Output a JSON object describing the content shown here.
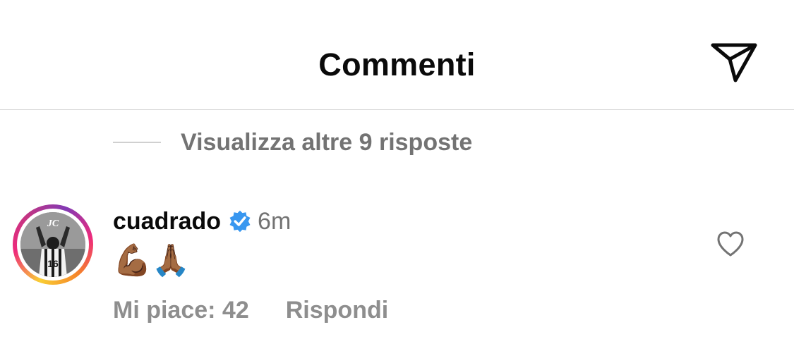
{
  "header": {
    "title": "Commenti",
    "share_icon": "paper-plane-icon"
  },
  "replies": {
    "view_more_label": "Visualizza altre 9 risposte"
  },
  "comment": {
    "username": "cuadrado",
    "verified": true,
    "verified_icon": "verified-badge-icon",
    "timestamp": "6m",
    "text": "💪🏾🙏🏾",
    "likes_label": "Mi piace: 42",
    "reply_label": "Rispondi",
    "like_icon": "heart-icon",
    "avatar_badge_text": "JC",
    "avatar_jersey_number": "16"
  },
  "colors": {
    "accent_verified": "#3897f0",
    "secondary_text": "#737373",
    "divider": "#dbdbdb"
  }
}
